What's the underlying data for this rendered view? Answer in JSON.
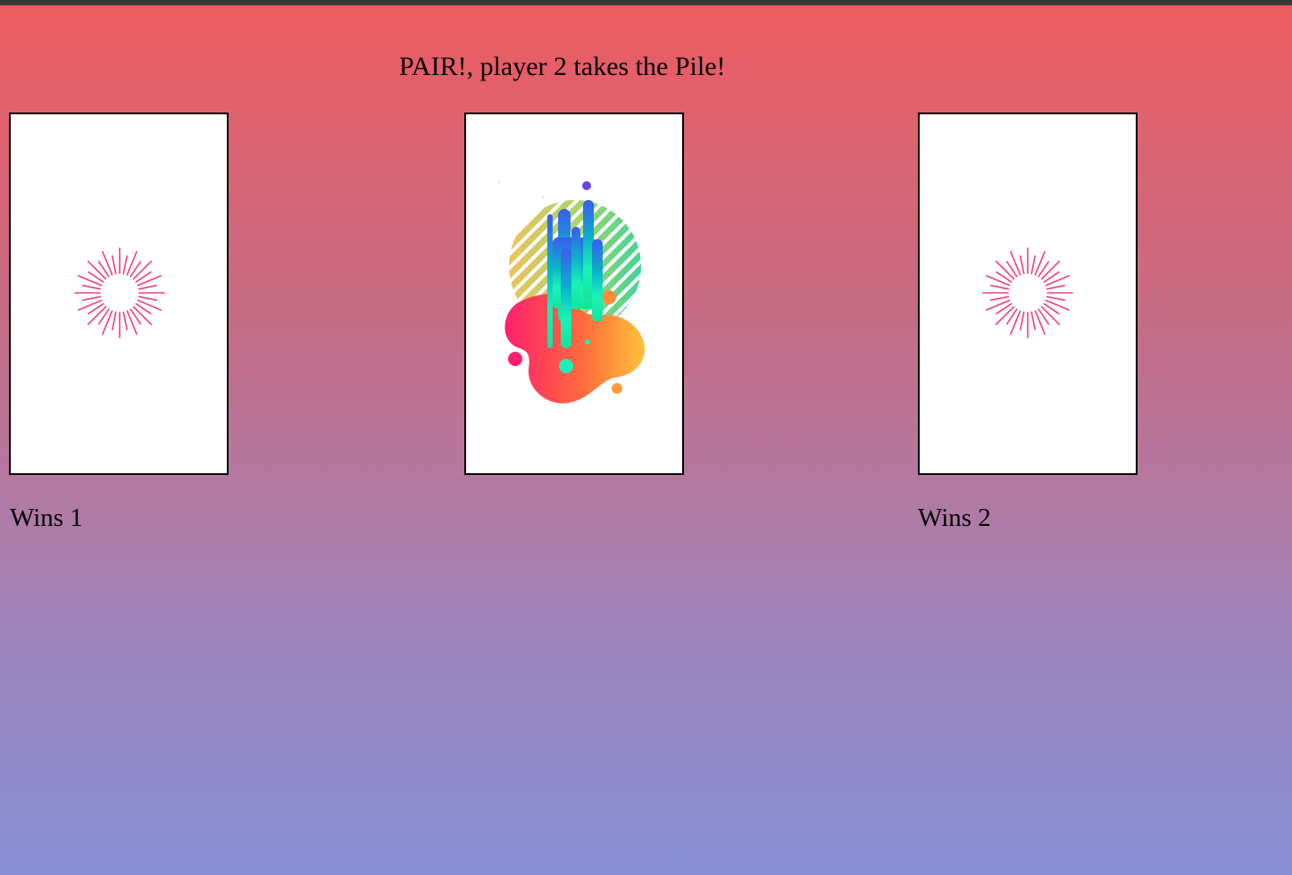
{
  "status": {
    "message": "PAIR!, player 2 takes the Pile!"
  },
  "players": [
    {
      "wins_label": "Wins 1",
      "card_face": "card-back-burst"
    },
    {
      "wins_label": "Wins 2",
      "card_face": "card-back-burst"
    }
  ],
  "pile": {
    "card_face": "abstract-paint-splash-card"
  },
  "colors": {
    "burst": "#f0407f",
    "card_background": "#ffffff",
    "card_border": "#000000",
    "background_top": "#ee5a5f",
    "background_bottom": "#8790d4"
  }
}
